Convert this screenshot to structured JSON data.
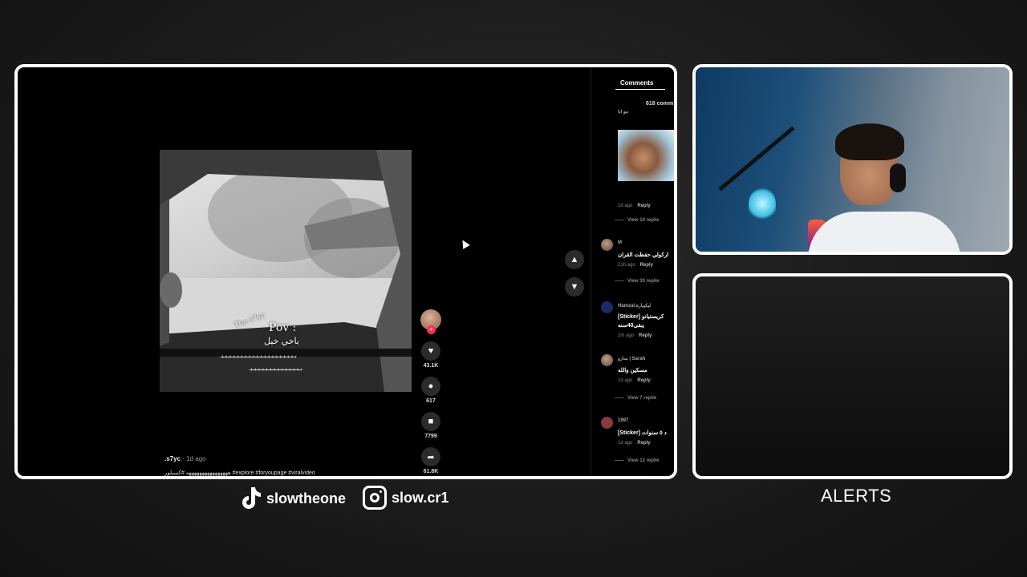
{
  "video": {
    "pov_title": "Pov :",
    "pov_arabic": "باخي خيل",
    "watermark": "The s7yc",
    "arrows_line1": "ﺑﺒﺒﺒﺒﺒﺒﺒﺒﺒﺒﺒﺒﺒﺒﺒﺒﺒﺒﺒ",
    "arrows_line2": "ﺑﺒﺒﺒﺒﺒﺒﺒﺒﺒﺒﺒﺒﺒ",
    "author": ".s7yc",
    "posted": "· 1d ago",
    "tags": "ههههههههههههههههه #كسبلور #explore #foryoupage #viralvideo"
  },
  "actions": {
    "like_count": "43.1K",
    "comment_count": "617",
    "save_count": "7799",
    "share_count": "61.8K"
  },
  "comments": {
    "tab_label": "Comments",
    "total": "618 comm",
    "items": [
      {
        "name": "مو انا",
        "text": "",
        "time": "1d ago",
        "reply": "Reply",
        "view": "View 10 replie"
      },
      {
        "name": "M",
        "text": "اركولي حفظت القران",
        "time": "21h ago",
        "reply": "Reply",
        "view": "View 30 replie"
      },
      {
        "name": "Hamzal.ليكيبارة",
        "text": "[Sticker] كريستيانو",
        "text2": "يبقى40سنه",
        "time": "2m ago",
        "reply": "Reply",
        "view": ""
      },
      {
        "name": "سارو | Sarah",
        "text": "مسكين والله",
        "time": "1d ago",
        "reply": "Reply",
        "view": "View 7 replie"
      },
      {
        "name": "1997",
        "text": "[Sticker] د ٥ سنوات",
        "time": "1d ago",
        "reply": "Reply",
        "view": "View 12 replie"
      }
    ]
  },
  "socials": {
    "tiktok": "slowtheone",
    "instagram": "slow.cr1"
  },
  "alerts_label": "ALERTS"
}
